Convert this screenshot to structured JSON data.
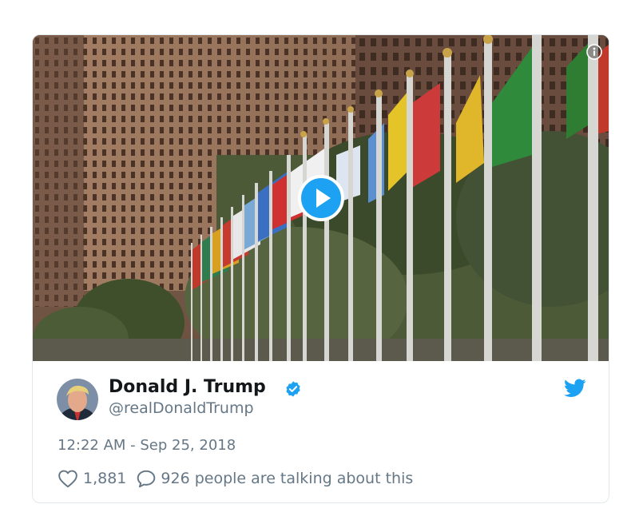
{
  "tweet": {
    "author_name": "Donald J. Trump",
    "author_handle": "@realDonaldTrump",
    "timestamp": "12:22 AM - Sep 25, 2018",
    "like_count": "1,881",
    "conversation_text": "926 people are talking about this"
  },
  "icons": {
    "like": "heart-icon",
    "reply": "speech-bubble-icon",
    "brand": "twitter-bird-icon",
    "verified": "verified-badge-icon",
    "info": "info-icon",
    "play": "play-icon"
  },
  "colors": {
    "name_text": "#14171a",
    "secondary_text": "#657786",
    "brand_blue": "#1da1f2",
    "border": "#e1e8ed"
  }
}
